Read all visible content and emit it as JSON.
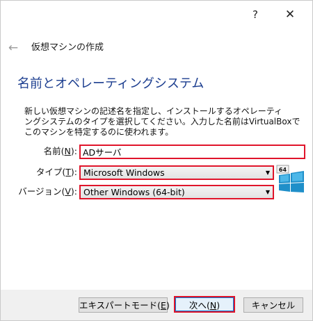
{
  "window": {
    "help_glyph": "?",
    "close_glyph": "✕"
  },
  "header": {
    "wizard_name": "仮想マシンの作成"
  },
  "page": {
    "title": "名前とオペレーティングシステム",
    "description_lines": [
      "新しい仮想マシンの記述名を指定し、インストールするオペレーティ",
      "ングシステムのタイプを選択してください。入力した名前はVirtualBoxで",
      "このマシンを特定するのに使われます。"
    ]
  },
  "form": {
    "name": {
      "label": "名前",
      "accel": "N",
      "value": "ADサーバ"
    },
    "type": {
      "label": "タイプ",
      "accel": "T",
      "value": "Microsoft Windows"
    },
    "version": {
      "label": "バージョン",
      "accel": "V",
      "value": "Other Windows (64-bit)"
    },
    "os_icon": {
      "name": "windows-64bit-icon",
      "badge": "64"
    }
  },
  "buttons": {
    "expert": {
      "label": "エキスパートモード",
      "accel": "E"
    },
    "next": {
      "label": "次へ",
      "accel": "N"
    },
    "cancel": {
      "label": "キャンセル"
    }
  },
  "colors": {
    "title_blue": "#1b3d8f",
    "highlight_red": "#e0142a"
  }
}
